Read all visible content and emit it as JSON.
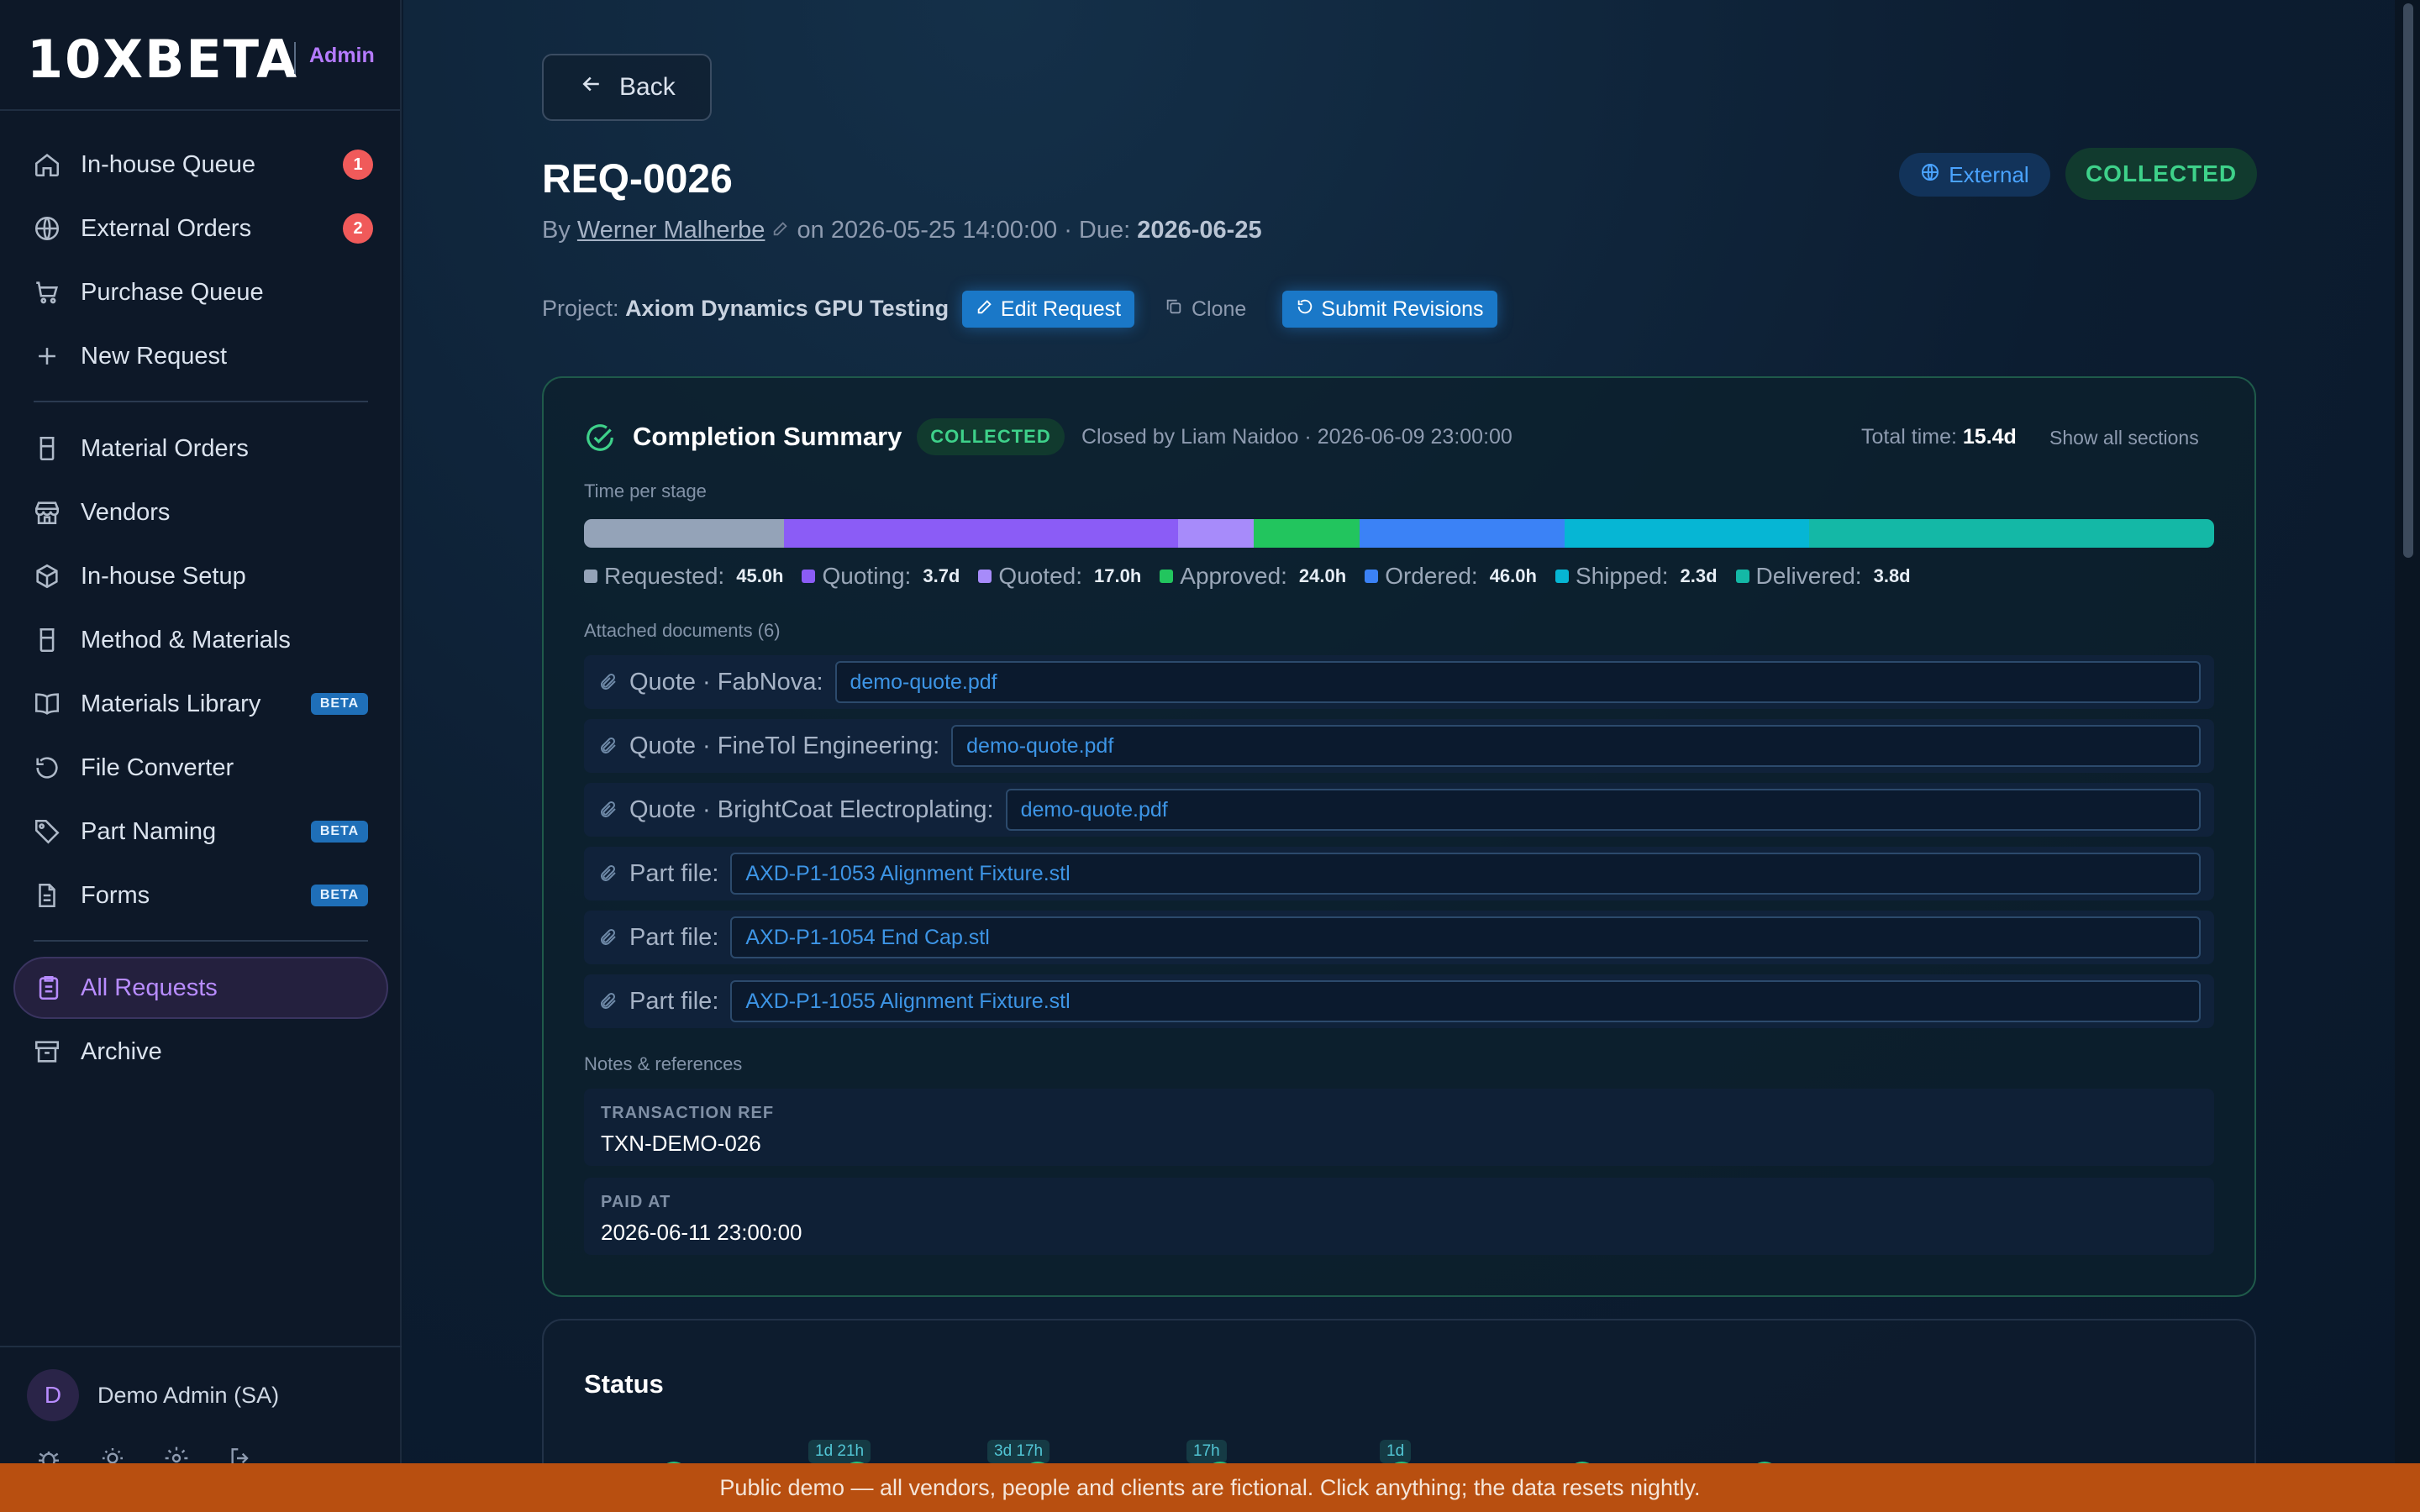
{
  "brand": {
    "logo": "10XBETA",
    "role": "Admin"
  },
  "sidebar": {
    "items": [
      {
        "label": "In-house Queue",
        "icon": "home-icon",
        "count": "1"
      },
      {
        "label": "External Orders",
        "icon": "globe-icon",
        "count": "2"
      },
      {
        "label": "Purchase Queue",
        "icon": "cart-icon"
      },
      {
        "label": "New Request",
        "icon": "plus-icon"
      },
      {
        "label": "Material Orders",
        "icon": "beaker-icon"
      },
      {
        "label": "Vendors",
        "icon": "store-icon"
      },
      {
        "label": "In-house Setup",
        "icon": "box-icon"
      },
      {
        "label": "Method & Materials",
        "icon": "beaker-icon"
      },
      {
        "label": "Materials Library",
        "icon": "book-icon",
        "badge": "BETA"
      },
      {
        "label": "File Converter",
        "icon": "refresh-icon"
      },
      {
        "label": "Part Naming",
        "icon": "tag-icon",
        "badge": "BETA"
      },
      {
        "label": "Forms",
        "icon": "document-icon",
        "badge": "BETA"
      },
      {
        "label": "All Requests",
        "icon": "clipboard-icon",
        "active": true
      },
      {
        "label": "Archive",
        "icon": "archive-icon"
      }
    ],
    "user": {
      "initial": "D",
      "name": "Demo Admin (SA)"
    },
    "footer_icons": [
      "bug-icon",
      "sun-icon",
      "settings-icon",
      "logout-icon"
    ]
  },
  "header": {
    "back_label": "Back",
    "title": "REQ-0026",
    "by_prefix": "By",
    "author": "Werner Malherbe",
    "on_text": "on 2026-05-25 14:00:00 · Due:",
    "due": "2026-06-25",
    "source_badge": "External",
    "status_badge": "COLLECTED"
  },
  "project": {
    "prefix": "Project:",
    "name": "Axiom Dynamics GPU Testing",
    "edit_label": "Edit Request",
    "clone_label": "Clone",
    "submit_label": "Submit Revisions"
  },
  "completion": {
    "title": "Completion Summary",
    "badge": "COLLECTED",
    "closed_by": "Closed by Liam Naidoo · 2026-06-09 23:00:00",
    "total_label": "Total time:",
    "total_value": "15.4d",
    "show_all": "Show all sections",
    "time_per_stage_label": "Time per stage",
    "stages": [
      {
        "name": "Requested:",
        "value": "45.0h",
        "hours": 45.0,
        "color": "#94a3b8"
      },
      {
        "name": "Quoting:",
        "value": "3.7d",
        "hours": 88.8,
        "color": "#8b5cf6"
      },
      {
        "name": "Quoted:",
        "value": "17.0h",
        "hours": 17.0,
        "color": "#a78bfa"
      },
      {
        "name": "Approved:",
        "value": "24.0h",
        "hours": 24.0,
        "color": "#22c55e"
      },
      {
        "name": "Ordered:",
        "value": "46.0h",
        "hours": 46.0,
        "color": "#3b82f6"
      },
      {
        "name": "Shipped:",
        "value": "2.3d",
        "hours": 55.2,
        "color": "#06b6d4"
      },
      {
        "name": "Delivered:",
        "value": "3.8d",
        "hours": 91.2,
        "color": "#14b8a6"
      }
    ],
    "attached_label": "Attached documents (6)",
    "documents": [
      {
        "label": "Quote · FabNova:",
        "file": "demo-quote.pdf"
      },
      {
        "label": "Quote · FineTol Engineering:",
        "file": "demo-quote.pdf"
      },
      {
        "label": "Quote · BrightCoat Electroplating:",
        "file": "demo-quote.pdf"
      },
      {
        "label": "Part file:",
        "file": "AXD-P1-1053 Alignment Fixture.stl"
      },
      {
        "label": "Part file:",
        "file": "AXD-P1-1054 End Cap.stl"
      },
      {
        "label": "Part file:",
        "file": "AXD-P1-1055 Alignment Fixture.stl"
      }
    ],
    "notes_label": "Notes & references",
    "refs": [
      {
        "key": "TRANSACTION REF",
        "value": "TXN-DEMO-026"
      },
      {
        "key": "PAID AT",
        "value": "2026-06-11 23:00:00"
      }
    ]
  },
  "status": {
    "title": "Status",
    "durations": [
      "1d 21h",
      "3d 17h",
      "17h",
      "1d"
    ]
  },
  "banner": "Public demo — all vendors, people and clients are fictional. Click anything; the data resets nightly."
}
